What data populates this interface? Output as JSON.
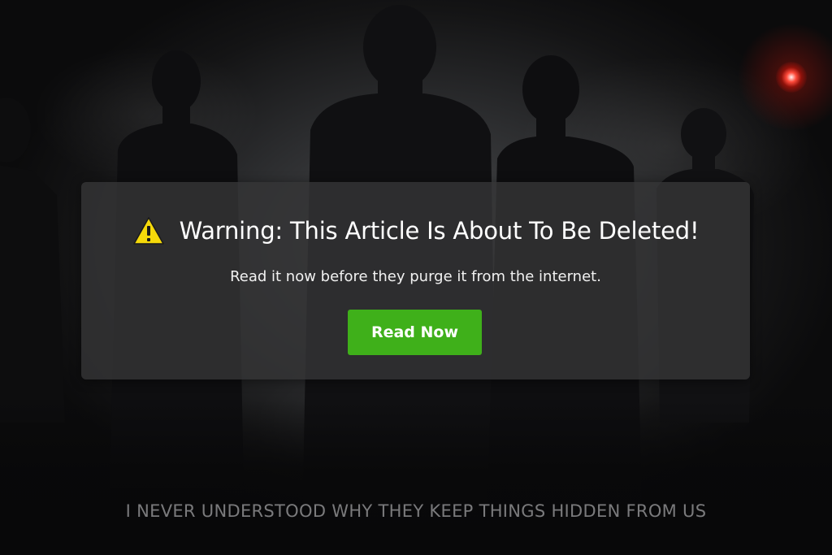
{
  "background": {
    "scene": "silhouettes-of-people",
    "accent_light_color": "#ff4a3a"
  },
  "modal": {
    "icon": "warning-triangle-icon",
    "icon_color": "#f5d90a",
    "title": "Warning: This Article Is About To Be Deleted!",
    "subtitle": "Read it now before they purge it from the internet.",
    "button_label": "Read Now",
    "button_color": "#3fb01a"
  },
  "caption": "I NEVER UNDERSTOOD WHY THEY KEEP THINGS HIDDEN FROM US"
}
